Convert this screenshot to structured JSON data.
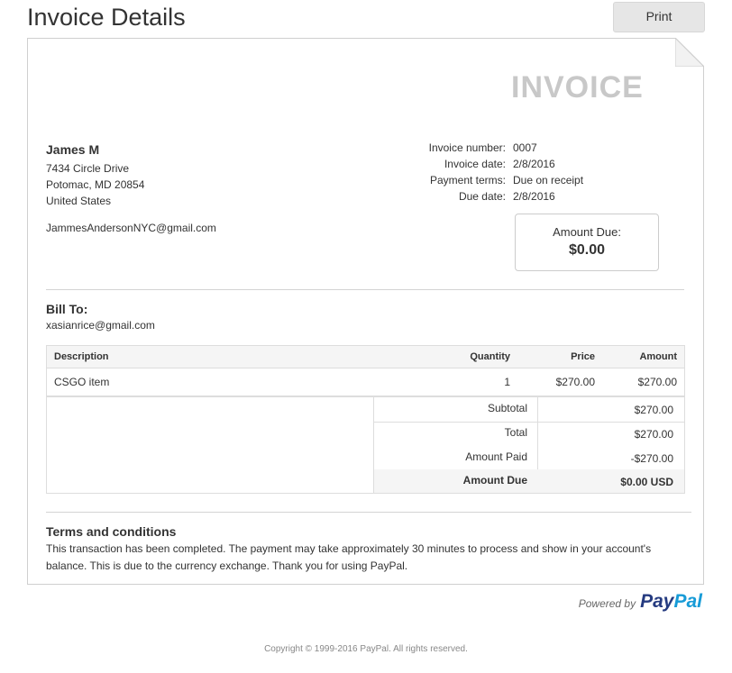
{
  "page": {
    "title": "Invoice Details",
    "print_label": "Print"
  },
  "invoice": {
    "heading": "INVOICE",
    "sender": {
      "name": "James M",
      "address_line1": "7434 Circle Drive",
      "address_line2": "Potomac, MD 20854",
      "country": "United States",
      "email": "JammesAndersonNYC@gmail.com"
    },
    "meta": [
      {
        "label": "Invoice number:",
        "value": "0007"
      },
      {
        "label": "Invoice date:",
        "value": "2/8/2016"
      },
      {
        "label": "Payment terms:",
        "value": "Due on receipt"
      },
      {
        "label": "Due date:",
        "value": "2/8/2016"
      }
    ],
    "amount_due_box": {
      "label": "Amount Due:",
      "value": "$0.00"
    },
    "bill_to": {
      "heading": "Bill To:",
      "email": "xasianrice@gmail.com"
    },
    "table": {
      "headers": {
        "description": "Description",
        "quantity": "Quantity",
        "price": "Price",
        "amount": "Amount"
      },
      "rows": [
        {
          "description": "CSGO item",
          "quantity": "1",
          "price": "$270.00",
          "amount": "$270.00"
        }
      ]
    },
    "totals": {
      "subtotal": {
        "label": "Subtotal",
        "value": "$270.00"
      },
      "total": {
        "label": "Total",
        "value": "$270.00"
      },
      "amount_paid": {
        "label": "Amount Paid",
        "value": "-$270.00"
      },
      "amount_due": {
        "label": "Amount Due",
        "value": "$0.00 USD"
      }
    },
    "terms": {
      "heading": "Terms and conditions",
      "body": "This transaction has been completed. The payment may take approximately 30 minutes to process and show in your account's balance. This is due to the currency exchange. Thank you for using PayPal."
    }
  },
  "footer": {
    "powered_by": "Powered by",
    "logo_part1": "Pay",
    "logo_part2": "Pal",
    "copyright": "Copyright © 1999-2016 PayPal. All rights reserved."
  },
  "colors": {
    "paypal_dark": "#253b80",
    "paypal_light": "#179bd7",
    "invoice_heading": "#c8c8c8"
  }
}
